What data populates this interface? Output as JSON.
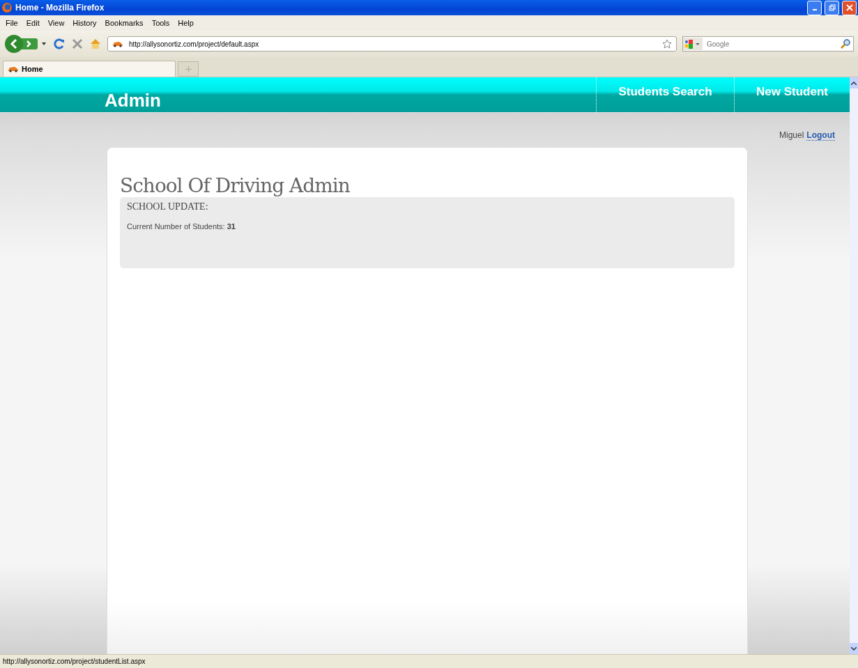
{
  "window": {
    "title": "Home - Mozilla Firefox"
  },
  "menu": [
    "File",
    "Edit",
    "View",
    "History",
    "Bookmarks",
    "Tools",
    "Help"
  ],
  "address_bar": {
    "value": "http://allysonortiz.com/project/default.aspx"
  },
  "search": {
    "placeholder": "Google"
  },
  "tabs": [
    {
      "label": "Home",
      "selected": true
    }
  ],
  "site": {
    "brand": "Admin",
    "nav": [
      {
        "label": "Students Search"
      },
      {
        "label": "New Student"
      }
    ],
    "user": "Miguel",
    "logout": "Logout"
  },
  "content": {
    "heading": "School Of Driving Admin",
    "panel_title": "SCHOOL UPDATE:",
    "stat_label": "Current Number of Students:",
    "stat_value": "31"
  },
  "status_bar": "http://allysonortiz.com/project/studentList.aspx"
}
